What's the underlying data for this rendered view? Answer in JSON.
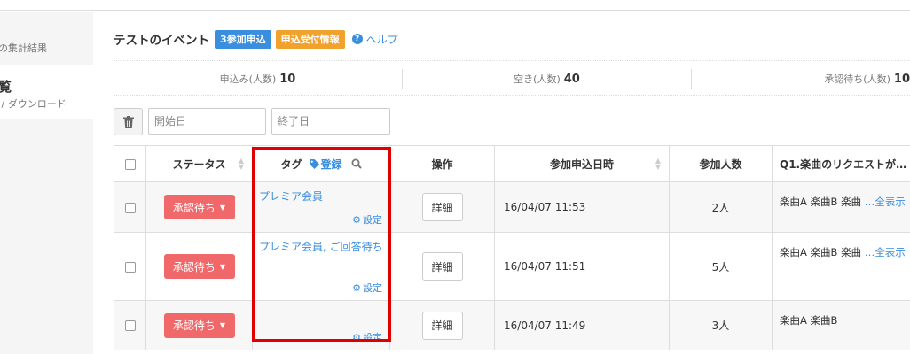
{
  "sidebar": {
    "item1": "タの集計結果",
    "item2_title": "覧",
    "item2_sub": "蔵 / ダウンロード"
  },
  "header": {
    "title": "テストのイベント",
    "badge_apply": "3参加申込",
    "badge_info": "申込受付情報",
    "help": "ヘルプ"
  },
  "stats": [
    {
      "label": "申込み(人数)",
      "value": "10"
    },
    {
      "label": "空き(人数)",
      "value": "40"
    },
    {
      "label": "承認待ち(人数)",
      "value": "10"
    }
  ],
  "filters": {
    "start_placeholder": "開始日",
    "end_placeholder": "終了日"
  },
  "table": {
    "headers": {
      "status": "ステータス",
      "tag": "タグ",
      "tag_register": "登録",
      "operation": "操作",
      "applied_at": "参加申込日時",
      "people": "参加人数",
      "q1": "Q1.楽曲のリクエストが…"
    },
    "setting_label": "設定",
    "rows": [
      {
        "status": "承認待ち",
        "tag": "プレミア会員",
        "detail": "詳細",
        "applied_at": "16/04/07 11:53",
        "people": "2人",
        "q1": "楽曲A 楽曲B 楽曲 ",
        "q1_more": "…全表示"
      },
      {
        "status": "承認待ち",
        "tag": "プレミア会員, ご回答待ち",
        "detail": "詳細",
        "applied_at": "16/04/07 11:51",
        "people": "5人",
        "q1": "楽曲A 楽曲B 楽曲 ",
        "q1_more": "…全表示"
      },
      {
        "status": "承認待ち",
        "tag": "",
        "detail": "詳細",
        "applied_at": "16/04/07 11:49",
        "people": "3人",
        "q1": "楽曲A 楽曲B",
        "q1_more": ""
      }
    ]
  },
  "colors": {
    "accent_blue": "#3a8ede",
    "status_red": "#f0686a",
    "badge_orange": "#f0a22c",
    "highlight_red": "#e00000"
  }
}
